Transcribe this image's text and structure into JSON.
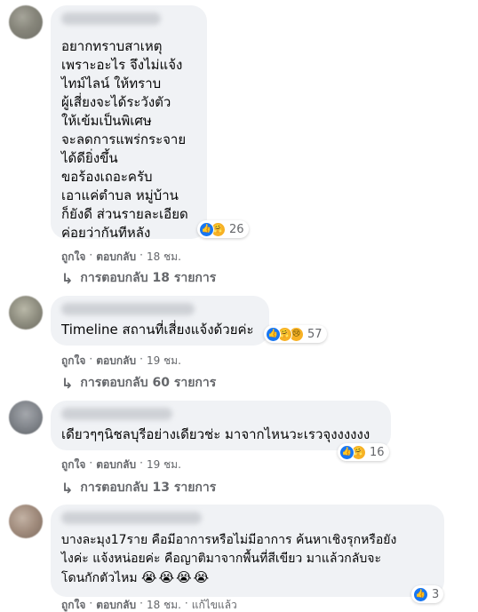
{
  "comments": [
    {
      "text": "อยากทราบสาเหตุ\nเพราะอะไร จึงไม่แจ้ง\nไทม์ไลน์ ให้ทราบ\nผู้เสี่ยงจะได้ระวังตัว\nให้เข้มเป็นพิเศษ\nจะลดการแพร่กระจาย\nได้ดียิ่งขึ้น\nขอร้องเถอะครับ\nเอาแค่ตำบล หมู่บ้าน\nก็ยังดี ส่วนรายละเอียด\nค่อยว่ากันทีหลัง",
      "reactions": [
        "like",
        "care"
      ],
      "reaction_count": "26",
      "like": "ถูกใจ",
      "reply": "ตอบกลับ",
      "time": "18 ชม.",
      "replies_label": "การตอบกลับ 18 รายการ"
    },
    {
      "text": "Timeline สถานที่เสี่ยงแจ้งด้วยค่ะ",
      "reactions": [
        "like",
        "care",
        "sad"
      ],
      "reaction_count": "57",
      "like": "ถูกใจ",
      "reply": "ตอบกลับ",
      "time": "19 ชม.",
      "replies_label": "การตอบกลับ 60 รายการ"
    },
    {
      "text": "เดียวๆๆนิชลบุรีอย่างเดียวช่ะ มาจากไหนวะเรวจุงงงงงง",
      "reactions": [
        "like",
        "care"
      ],
      "reaction_count": "16",
      "like": "ถูกใจ",
      "reply": "ตอบกลับ",
      "time": "19 ชม.",
      "replies_label": "การตอบกลับ 13 รายการ"
    },
    {
      "text": "บางละมุง17ราย คือมีอาการหรือไม่มีอาการ ค้นหาเชิงรุกหรือยัง\nไงค่ะ แจ้งหน่อยค่ะ คือญาติมาจากพื้นที่สีเขียว มาแล้วกลับจะ\nโดนกักตัวไหม",
      "emoji_tail": "😭😭😭😭",
      "reactions": [
        "like"
      ],
      "reaction_count": "3",
      "like": "ถูกใจ",
      "reply": "ตอบกลับ",
      "time": "18 ชม.",
      "edited": "แก้ไขแล้ว"
    }
  ],
  "icons": {
    "like": "like-icon",
    "care": "care-icon",
    "sad": "sad-icon",
    "reply_arrow": "reply-arrow-icon"
  },
  "colors": {
    "bubble": "#f0f2f5",
    "like_blue": "#1877f2",
    "meta_gray": "#65676b"
  }
}
